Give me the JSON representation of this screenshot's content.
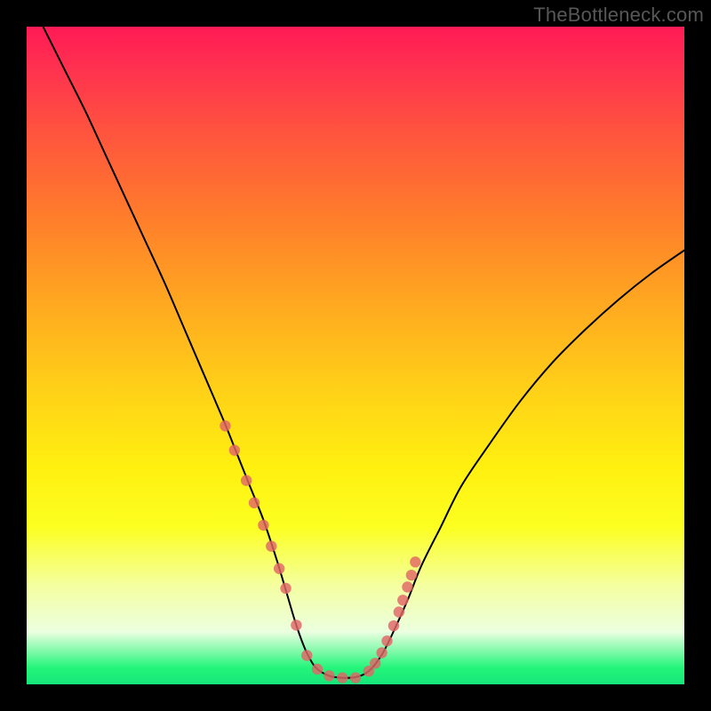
{
  "watermark": "TheBottleneck.com",
  "chart_data": {
    "type": "line",
    "title": "",
    "xlabel": "",
    "ylabel": "",
    "xlim": [
      0,
      100
    ],
    "ylim": [
      0,
      100
    ],
    "series": [
      {
        "name": "bottleneck-curve",
        "x": [
          0,
          3,
          6,
          9,
          12,
          15,
          18,
          21,
          24,
          27,
          30,
          32,
          34,
          36,
          38,
          39.5,
          41,
          42.5,
          44,
          46,
          48,
          50,
          52,
          54,
          56,
          58,
          60,
          63,
          66,
          70,
          75,
          80,
          85,
          90,
          95,
          100
        ],
        "values": [
          105,
          99,
          93,
          87,
          80.5,
          74,
          67.5,
          61,
          54,
          47,
          40,
          35,
          30,
          25,
          19,
          14,
          9,
          5,
          2.5,
          1.3,
          1,
          1.1,
          2,
          4.5,
          8.5,
          13,
          18,
          24,
          30,
          36,
          43,
          49,
          54,
          58.5,
          62.5,
          66
        ]
      }
    ],
    "scatter": {
      "name": "highlight-dots",
      "x": [
        30.2,
        31.6,
        33.4,
        34.6,
        36.0,
        37.2,
        38.4,
        39.4,
        41.0,
        42.6,
        44.2,
        46.0,
        48.0,
        50.0,
        52.0,
        53.0,
        54.0,
        54.8,
        55.8,
        56.6,
        57.2,
        57.9,
        58.5,
        59.1
      ],
      "values": [
        39.3,
        35.6,
        31.0,
        27.6,
        24.2,
        21.0,
        17.6,
        14.6,
        9.0,
        4.4,
        2.3,
        1.3,
        1.0,
        1.0,
        2.0,
        3.2,
        4.8,
        6.6,
        8.9,
        11.0,
        12.8,
        14.8,
        16.6,
        18.6
      ]
    }
  }
}
